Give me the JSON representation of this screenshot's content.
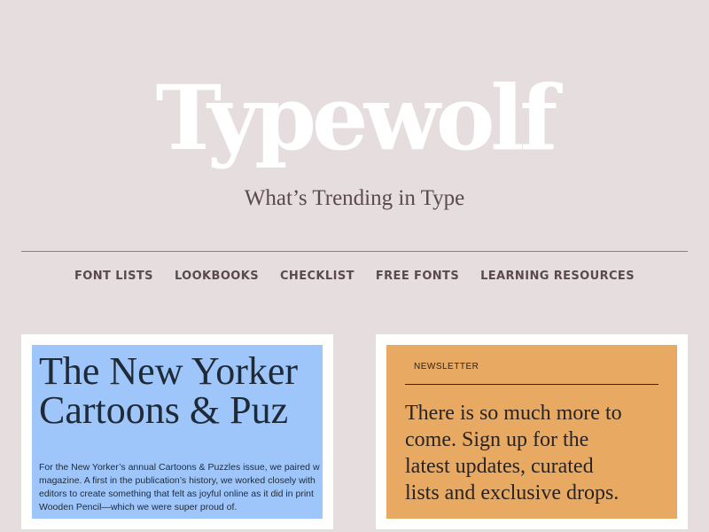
{
  "header": {
    "logo": "Typewolf",
    "tagline": "What’s Trending in Type"
  },
  "nav": {
    "items": [
      {
        "label": "FONT LISTS"
      },
      {
        "label": "LOOKBOOKS"
      },
      {
        "label": "CHECKLIST"
      },
      {
        "label": "FREE FONTS"
      },
      {
        "label": "LEARNING RESOURCES"
      }
    ]
  },
  "cards": {
    "newyorker": {
      "title_lines": [
        "The New Yorker",
        "Cartoons & Puz"
      ],
      "body_lines": [
        "For the New Yorker’s annual Cartoons & Puzzles issue, we paired w",
        "magazine. A first in the publication’s history, we worked closely with",
        "editors to create something that felt as joyful online as it did in print",
        "Wooden Pencil—which we were super proud of."
      ]
    },
    "newsletter": {
      "label": "NEWSLETTER",
      "text_lines": [
        "There is so much more to",
        "come. Sign up for the",
        "latest updates, curated",
        "lists and exclusive drops."
      ]
    }
  },
  "colors": {
    "background": "#e6dddf",
    "card_blue": "#9ec6fb",
    "card_orange": "#e8aa62",
    "nav_text": "#5a4a4e"
  }
}
